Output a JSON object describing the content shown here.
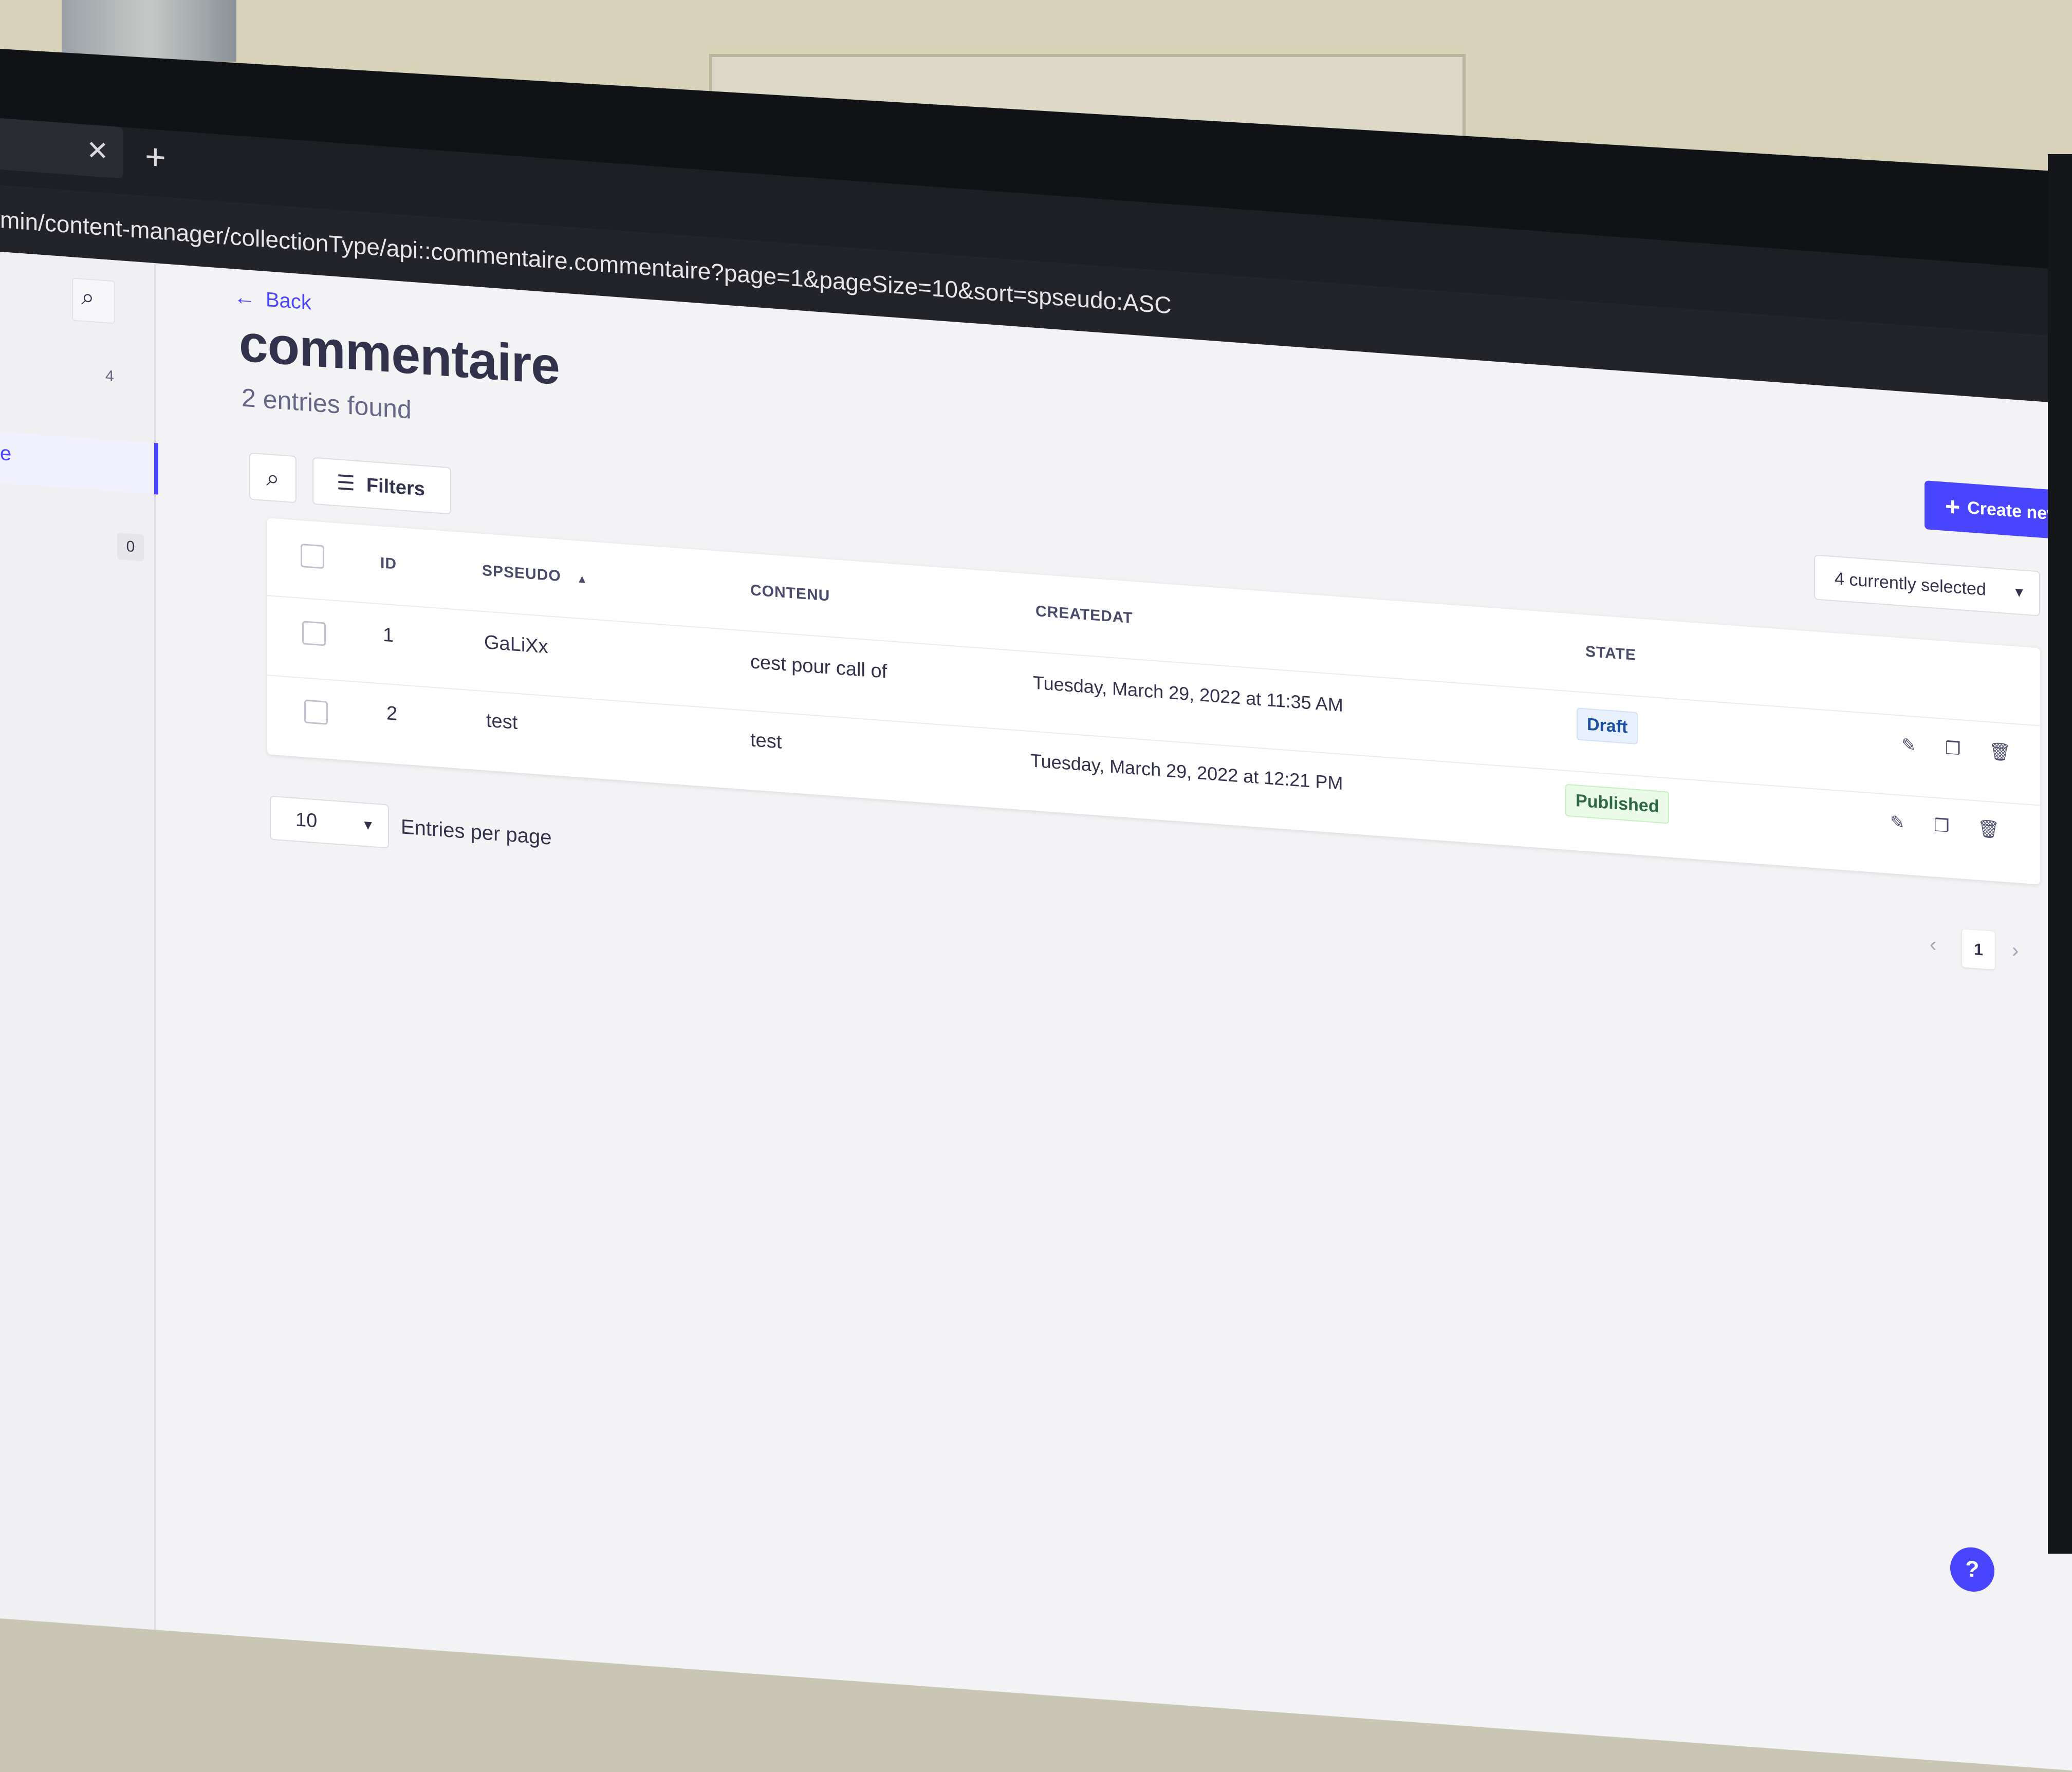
{
  "browser": {
    "tab_close": "✕",
    "new_tab": "+",
    "url": "min/content-manager/collectionType/api::commentaire.commentaire?page=1&pageSize=10&sort=spseudo:ASC"
  },
  "sidebar": {
    "badge_top": "4",
    "active_item_label": "e",
    "badge_bottom": "0"
  },
  "header": {
    "back_label": "Back",
    "title": "commentaire",
    "subtitle": "2 entries found",
    "create_label": "Create new en"
  },
  "toolbar": {
    "filters_label": "Filters",
    "columns_select_value": "4 currently selected"
  },
  "table": {
    "columns": [
      "ID",
      "SPSEUDO",
      "CONTENU",
      "CREATEDAT",
      "STATE"
    ],
    "sort_column": "SPSEUDO",
    "sort_direction": "ascending",
    "rows": [
      {
        "id": "1",
        "spseudo": "GaLiXx",
        "contenu": "cest pour call of",
        "createdat": "Tuesday, March 29, 2022 at 11:35 AM",
        "state": "Draft"
      },
      {
        "id": "2",
        "spseudo": "test",
        "contenu": "test",
        "createdat": "Tuesday, March 29, 2022 at 12:21 PM",
        "state": "Published"
      }
    ]
  },
  "footer": {
    "page_size": "10",
    "page_size_label": "Entries per page",
    "current_page": "1"
  },
  "help": {
    "label": "?"
  },
  "colors": {
    "primary": "#4945ff",
    "draft_bg": "#e8f0fb",
    "published_bg": "#eafbe7",
    "text": "#32324d"
  }
}
